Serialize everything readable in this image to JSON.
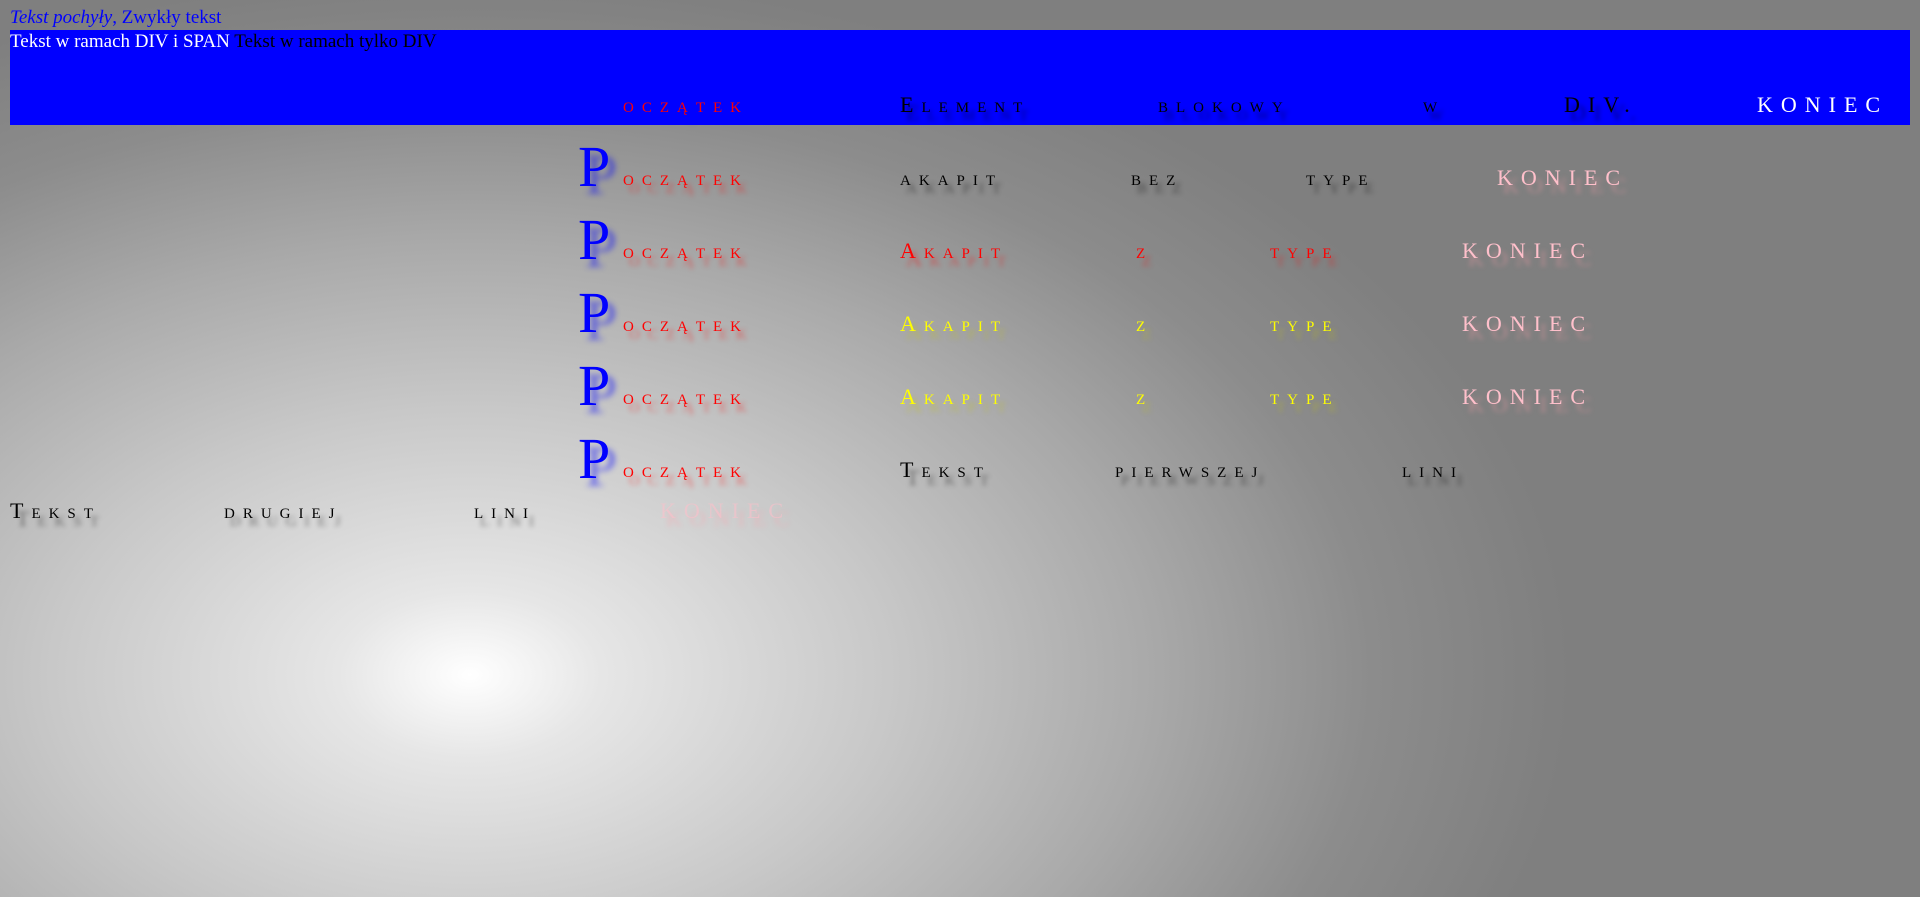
{
  "top": {
    "italic": "Tekst pochyły",
    "normal": ", Zwykły tekst"
  },
  "div_block": {
    "span_text": "Tekst w ramach DIV i SPAN",
    "div_text": " Tekst w ramach tylko DIV"
  },
  "row_div": {
    "poczatek": "oczątek",
    "w1": "Element",
    "w2": "blokowy",
    "w3": "w",
    "w4": "DIV.",
    "koniec": "KONIEC"
  },
  "rows": [
    {
      "big": "P",
      "poczatek": "oczątek",
      "w1": "akapit",
      "w2": "bez",
      "w3": "type",
      "koniec": "KONIEC"
    },
    {
      "big": "P",
      "poczatek": "oczątek",
      "w1": "Akapit",
      "w2": "z",
      "w3": "type",
      "koniec": "KONIEC"
    },
    {
      "big": "P",
      "poczatek": "oczątek",
      "w1": "Akapit",
      "w2": "z",
      "w3": "type",
      "koniec": "KONIEC"
    },
    {
      "big": "P",
      "poczatek": "oczątek",
      "w1": "Akapit",
      "w2": "z",
      "w3": "type",
      "koniec": "KONIEC"
    },
    {
      "big": "P",
      "poczatek": "oczątek",
      "w1": "Tekst",
      "w2": "pierwszej",
      "w3": "lini"
    }
  ],
  "second_line": {
    "w1": "Tekst",
    "w2": "drugiej",
    "w3": "lini",
    "koniec": "KONIEC"
  },
  "colors": {
    "blue": "#0000ff",
    "red": "#ff0000",
    "yellow": "#ffff00",
    "pink": "#ffc0cb"
  }
}
